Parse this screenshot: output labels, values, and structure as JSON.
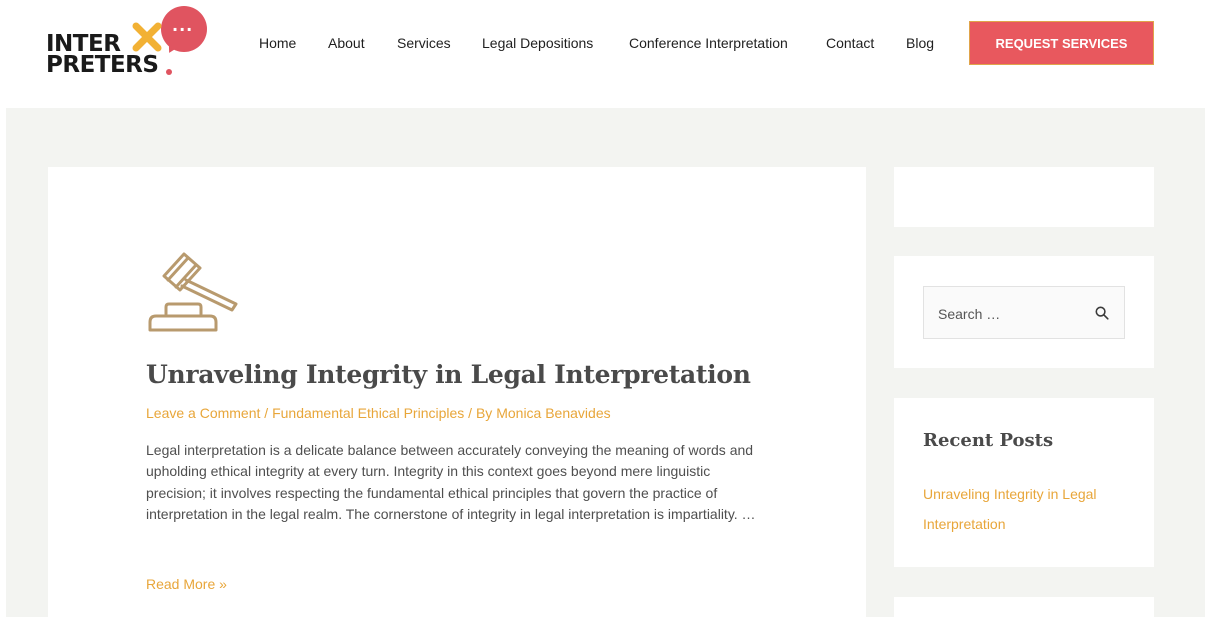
{
  "header": {
    "logo": {
      "line1": "INTER",
      "line2": "PRETERS",
      "bubble_dots": "...",
      "colors": {
        "bubble": "#e05460",
        "x_mark": "#f2b134",
        "text": "#1a1a1a"
      }
    },
    "nav": [
      {
        "label": "Home"
      },
      {
        "label": "About"
      },
      {
        "label": "Services"
      },
      {
        "label": "Legal Depositions"
      },
      {
        "label": "Conference Interpretation"
      },
      {
        "label": "Contact"
      },
      {
        "label": "Blog"
      }
    ],
    "cta_label": "REQUEST SERVICES"
  },
  "article": {
    "icon": "gavel-icon",
    "title": "Unraveling Integrity in Legal Interpretation",
    "meta": {
      "comment_link": "Leave a Comment",
      "separator": " / ",
      "category": "Fundamental Ethical Principles",
      "by_prefix": " / By ",
      "author": "Monica Benavides"
    },
    "excerpt": "Legal interpretation is a delicate balance between accurately conveying the meaning of words and upholding ethical integrity at every turn. Integrity in this context goes beyond mere linguistic precision; it involves respecting the fundamental ethical principles that govern the practice of interpretation in the legal realm. The cornerstone of integrity in legal interpretation is impartiality. …",
    "read_more": "Read More »"
  },
  "sidebar": {
    "search": {
      "placeholder": "Search …",
      "icon": "search-icon"
    },
    "recent_posts": {
      "title": "Recent Posts",
      "items": [
        {
          "label": "Unraveling Integrity in Legal Interpretation"
        }
      ]
    }
  },
  "colors": {
    "accent": "#e8a63a",
    "cta_bg": "#e8585e",
    "content_bg": "#f3f4f1",
    "gavel": "#b89a6e"
  }
}
